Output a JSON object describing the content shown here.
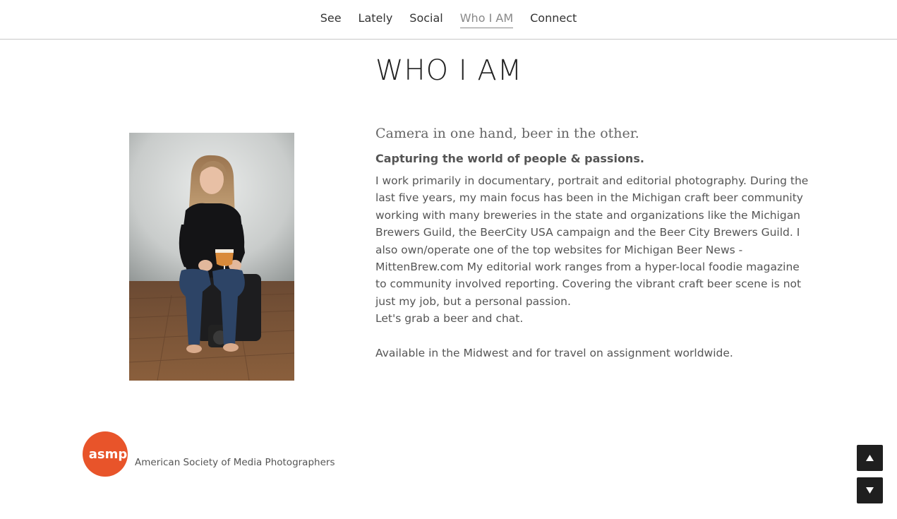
{
  "nav": {
    "items": [
      {
        "label": "See"
      },
      {
        "label": "Lately"
      },
      {
        "label": "Social"
      },
      {
        "label": "Who I AM",
        "active": true
      },
      {
        "label": "Connect"
      }
    ]
  },
  "page": {
    "title": "WHO I AM"
  },
  "about": {
    "tagline": "Camera in one hand, beer in the other.",
    "subhead": "Capturing the world of people & passions.",
    "paragraphs": [
      "I work primarily in documentary, portrait and editorial photography. During the last five years, my main focus has been in the Michigan craft beer community working with many breweries in the state and organizations like the Michigan Brewers Guild, the BeerCity USA campaign and the Beer City Brewers Guild. I also own/operate one of the top websites for Michigan Beer News - MittenBrew.com My editorial work ranges from a hyper-local foodie magazine to community involved reporting. Covering the vibrant craft beer scene is not just my job, but a personal passion.",
      "Let's grab a beer and chat.",
      "Available in the Midwest and for travel on assignment worldwide."
    ]
  },
  "affiliation": {
    "logo_text": "asmp",
    "name": "American Society of Media Photographers",
    "logo_color": "#e8542a"
  },
  "scroll": {
    "up_icon": "triangle-up-icon",
    "down_icon": "triangle-down-icon"
  }
}
